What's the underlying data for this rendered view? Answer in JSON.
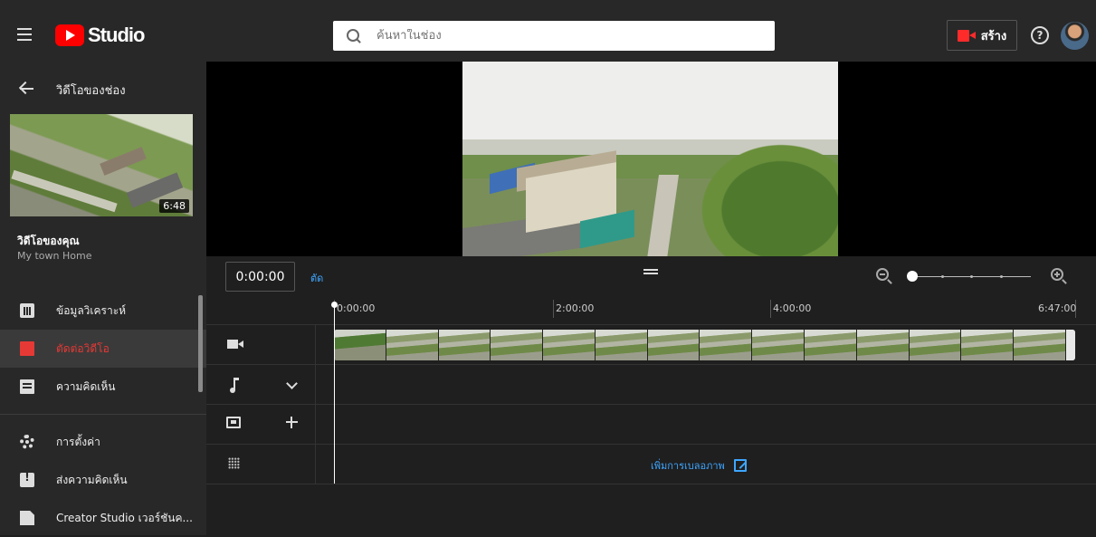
{
  "app": {
    "logo_text": "Studio",
    "search_placeholder": "ค้นหาในช่อง",
    "create_label": "สร้าง",
    "help_symbol": "?"
  },
  "sidebar": {
    "back_label": "วิดีโอของช่อง",
    "thumbnail_duration": "6:48",
    "your_video_label": "วิดีโอของคุณ",
    "video_title": "My town Home",
    "items": [
      {
        "label": "ข้อมูลวิเคราะห์",
        "icon": "analytics-icon",
        "active": false
      },
      {
        "label": "ตัดต่อวิดีโอ",
        "icon": "editor-icon",
        "active": true
      },
      {
        "label": "ความคิดเห็น",
        "icon": "comments-icon",
        "active": false
      },
      {
        "label": "การตั้งค่า",
        "icon": "settings-icon",
        "active": false
      },
      {
        "label": "ส่งความคิดเห็น",
        "icon": "feedback-icon",
        "active": false
      },
      {
        "label": "Creator Studio เวอร์ชันค...",
        "icon": "creator-studio-classic-icon",
        "active": false
      }
    ]
  },
  "editor": {
    "timecode": "0:00:00",
    "trim_label": "ตัด",
    "ruler": [
      "0:00:00",
      "2:00:00",
      "4:00:00",
      "6:47:00"
    ],
    "add_blur_label": "เพิ่มการเบลอภาพ",
    "film_frames": 14
  },
  "colors": {
    "accent_red": "#ff0000",
    "link_blue": "#3ea6ff",
    "active_red": "#e53935"
  }
}
